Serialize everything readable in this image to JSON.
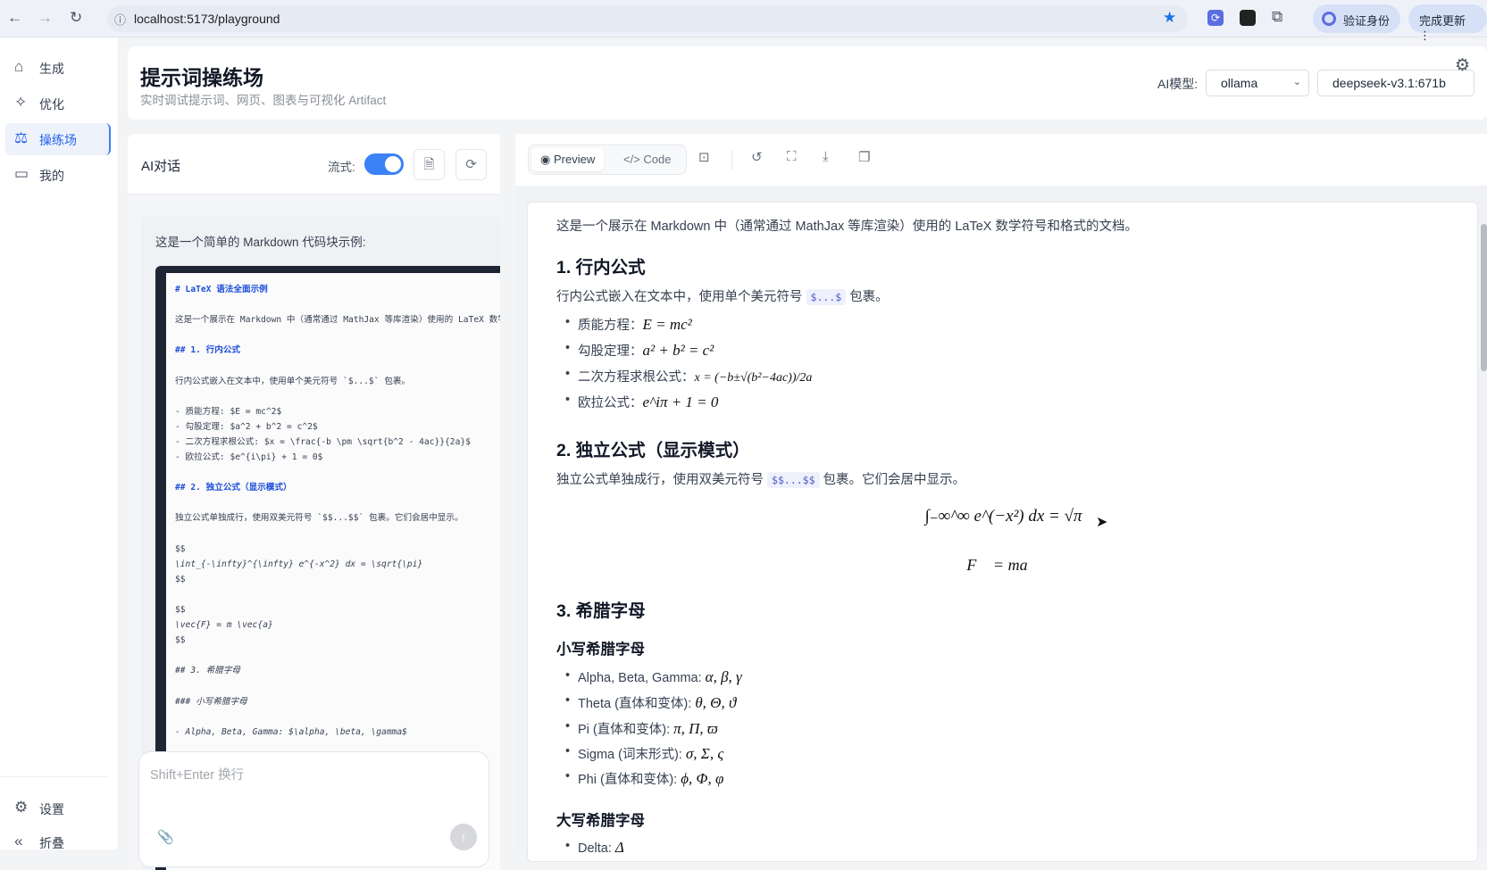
{
  "browser": {
    "url": "localhost:5173/playground",
    "verify_label": "验证身份",
    "update_label": "完成更新"
  },
  "sidebar": {
    "items": [
      {
        "label": "生成",
        "icon": "home"
      },
      {
        "label": "优化",
        "icon": "sparkle"
      },
      {
        "label": "操练场",
        "icon": "playground",
        "active": true
      },
      {
        "label": "我的",
        "icon": "folder"
      }
    ],
    "settings": "设置",
    "collapse": "折叠"
  },
  "header": {
    "title": "提示词操练场",
    "subtitle": "实时调试提示词、网页、图表与可视化 Artifact",
    "model_label": "AI模型:",
    "provider": "ollama",
    "model": "deepseek-v3.1:671b"
  },
  "chat": {
    "title": "AI对话",
    "stream_label": "流式:",
    "stream_on": true,
    "message_intro": "这是一个简单的 Markdown 代码块示例:",
    "placeholder": "Shift+Enter 换行",
    "code_lines": [
      {
        "t": "# LaTeX 语法全面示例",
        "k": "h"
      },
      {
        "t": "",
        "k": ""
      },
      {
        "t": "这是一个展示在 Markdown 中（通常通过 MathJax 等库渲染）使用的 LaTeX 数学符号和格式的文档。",
        "k": ""
      },
      {
        "t": "",
        "k": ""
      },
      {
        "t": "## 1. 行内公式",
        "k": "h"
      },
      {
        "t": "",
        "k": ""
      },
      {
        "t": "行内公式嵌入在文本中，使用单个美元符号 `$...$` 包裹。",
        "k": ""
      },
      {
        "t": "",
        "k": ""
      },
      {
        "t": "- 质能方程: $E = mc^2$",
        "k": ""
      },
      {
        "t": "- 勾股定理: $a^2 + b^2 = c^2$",
        "k": ""
      },
      {
        "t": "- 二次方程求根公式: $x = \\frac{-b \\pm \\sqrt{b^2 - 4ac}}{2a}$",
        "k": ""
      },
      {
        "t": "- 欧拉公式: $e^{i\\pi} + 1 = 0$",
        "k": ""
      },
      {
        "t": "",
        "k": ""
      },
      {
        "t": "## 2. 独立公式（显示模式）",
        "k": "h"
      },
      {
        "t": "",
        "k": ""
      },
      {
        "t": "独立公式单独成行，使用双美元符号 `$$...$$` 包裹。它们会居中显示。",
        "k": ""
      },
      {
        "t": "",
        "k": ""
      },
      {
        "t": "$$",
        "k": ""
      },
      {
        "t": "\\int_{-\\infty}^{\\infty} e^{-x^2} dx = \\sqrt{\\pi}",
        "k": "i"
      },
      {
        "t": "$$",
        "k": ""
      },
      {
        "t": "",
        "k": ""
      },
      {
        "t": "$$",
        "k": ""
      },
      {
        "t": "\\vec{F} = m \\vec{a}",
        "k": "i"
      },
      {
        "t": "$$",
        "k": ""
      },
      {
        "t": "",
        "k": ""
      },
      {
        "t": "## 3. 希腊字母",
        "k": "i"
      },
      {
        "t": "",
        "k": ""
      },
      {
        "t": "### 小写希腊字母",
        "k": "i"
      },
      {
        "t": "",
        "k": ""
      },
      {
        "t": "- Alpha, Beta, Gamma: $\\alpha, \\beta, \\gamma$",
        "k": "i"
      }
    ]
  },
  "preview": {
    "tab_preview": "Preview",
    "tab_code": "Code",
    "intro": "这是一个展示在 Markdown 中（通常通过 MathJax 等库渲染）使用的 LaTeX 数学符号和格式的文档。",
    "s1": "1. 行内公式",
    "s1_p_a": "行内公式嵌入在文本中，使用单个美元符号",
    "s1_code": "$...$",
    "s1_p_b": "包裹。",
    "s1_items": [
      {
        "label": "质能方程：",
        "math": "E = mc²"
      },
      {
        "label": "勾股定理：",
        "math": "a² + b² = c²"
      },
      {
        "label": "二次方程求根公式：",
        "math": "x = (−b±√(b²−4ac))/2a"
      },
      {
        "label": "欧拉公式：",
        "math": "e^iπ + 1 = 0"
      }
    ],
    "s2": "2. 独立公式（显示模式）",
    "s2_p_a": "独立公式单独成行，使用双美元符号",
    "s2_code": "$$...$$",
    "s2_p_b": "包裹。它们会居中显示。",
    "eq1": "∫₋∞^∞ e^(−x²) dx = √π",
    "eq2": "F⃗ = ma⃗",
    "s3": "3. 希腊字母",
    "s3_sub1": "小写希腊字母",
    "greek": [
      {
        "label": "Alpha, Beta, Gamma: ",
        "math": "α, β, γ"
      },
      {
        "label": "Theta (直体和变体): ",
        "math": "θ, Θ, ϑ"
      },
      {
        "label": "Pi (直体和变体): ",
        "math": "π, Π, ϖ"
      },
      {
        "label": "Sigma (词末形式): ",
        "math": "σ, Σ, ς"
      },
      {
        "label": "Phi (直体和变体): ",
        "math": "ϕ, Φ, φ"
      }
    ],
    "s3_sub2": "大写希腊字母",
    "delta_label": "Delta: ",
    "delta_math": "Δ"
  },
  "colors": {
    "accent": "#3b82f6",
    "active_bg": "#eef2fb"
  }
}
